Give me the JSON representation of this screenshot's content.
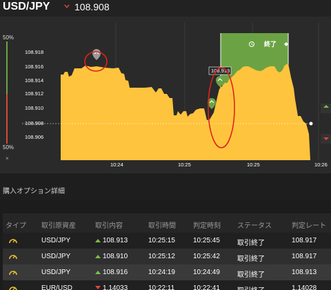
{
  "header": {
    "pair": "USD/JPY",
    "price": "108.908",
    "price_direction": "down",
    "down_color": "#e0453c",
    "up_color": "#7bc043"
  },
  "chart": {
    "y_ticks": [
      "108.918",
      "108.916",
      "108.914",
      "108.912",
      "108.910",
      "108.908",
      "108.906"
    ],
    "x_ticks": [
      "10:24",
      "10:25",
      "10:25",
      "10:26"
    ],
    "ratio_top": "50%",
    "ratio_bottom": "50%",
    "ratio_close": "×",
    "marker_label": "108.913",
    "end_label": "終了",
    "area_color": "#ffc43d",
    "zone_color": "#6ba344"
  },
  "details": {
    "title": "購入オプション詳細"
  },
  "table": {
    "headers": [
      "タイプ",
      "取引原資産",
      "取引内容",
      "取引時間",
      "判定時刻",
      "ステータス",
      "判定レート"
    ],
    "rows": [
      {
        "asset": "USD/JPY",
        "direction": "up",
        "rate": "108.913",
        "time": "10:25:15",
        "judge": "10:25:45",
        "status": "取引終了",
        "judge_rate": "108.917"
      },
      {
        "asset": "USD/JPY",
        "direction": "up",
        "rate": "108.910",
        "time": "10:25:12",
        "judge": "10:25:42",
        "status": "取引終了",
        "judge_rate": "108.917"
      },
      {
        "asset": "USD/JPY",
        "direction": "up",
        "rate": "108.916",
        "time": "10:24:19",
        "judge": "10:24:49",
        "status": "取引終了",
        "judge_rate": "108.913"
      },
      {
        "asset": "EUR/USD",
        "direction": "down",
        "rate": "1.14033",
        "time": "10:22:11",
        "judge": "10:22:41",
        "status": "取引終了",
        "judge_rate": "1.14028"
      }
    ]
  }
}
